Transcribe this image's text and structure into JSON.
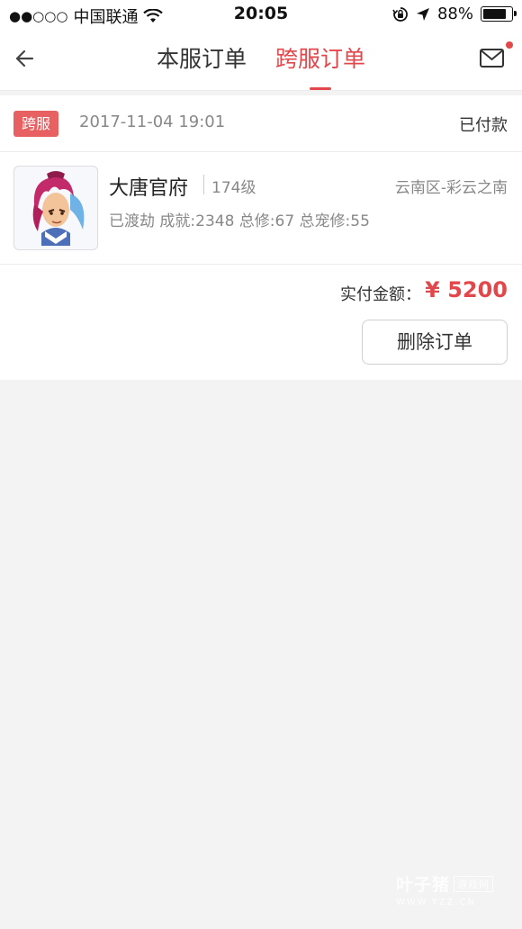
{
  "status_bar": {
    "signal_dots": "●●○○○",
    "carrier": "中国联通",
    "time": "20:05",
    "battery": "88%",
    "battery_level": 0.88
  },
  "nav": {
    "tabs": [
      {
        "label": "本服订单",
        "active": false
      },
      {
        "label": "跨服订单",
        "active": true
      }
    ],
    "has_unread_mail": true
  },
  "order": {
    "badge": "跨服",
    "datetime": "2017-11-04 19:01",
    "status": "已付款",
    "character": {
      "name": "大唐官府",
      "level": "174级",
      "server": "云南区-彩云之南",
      "stats": "已渡劫 成就:2348 总修:67 总宠修:55"
    },
    "amount_label": "实付金额：",
    "amount": "¥ 5200",
    "delete_label": "删除订单"
  },
  "watermark": {
    "brand": "叶子猪",
    "tag": "游戏网",
    "url": "WWW.YZZ.CN"
  },
  "colors": {
    "accent": "#e2484b",
    "badge": "#e86162"
  }
}
